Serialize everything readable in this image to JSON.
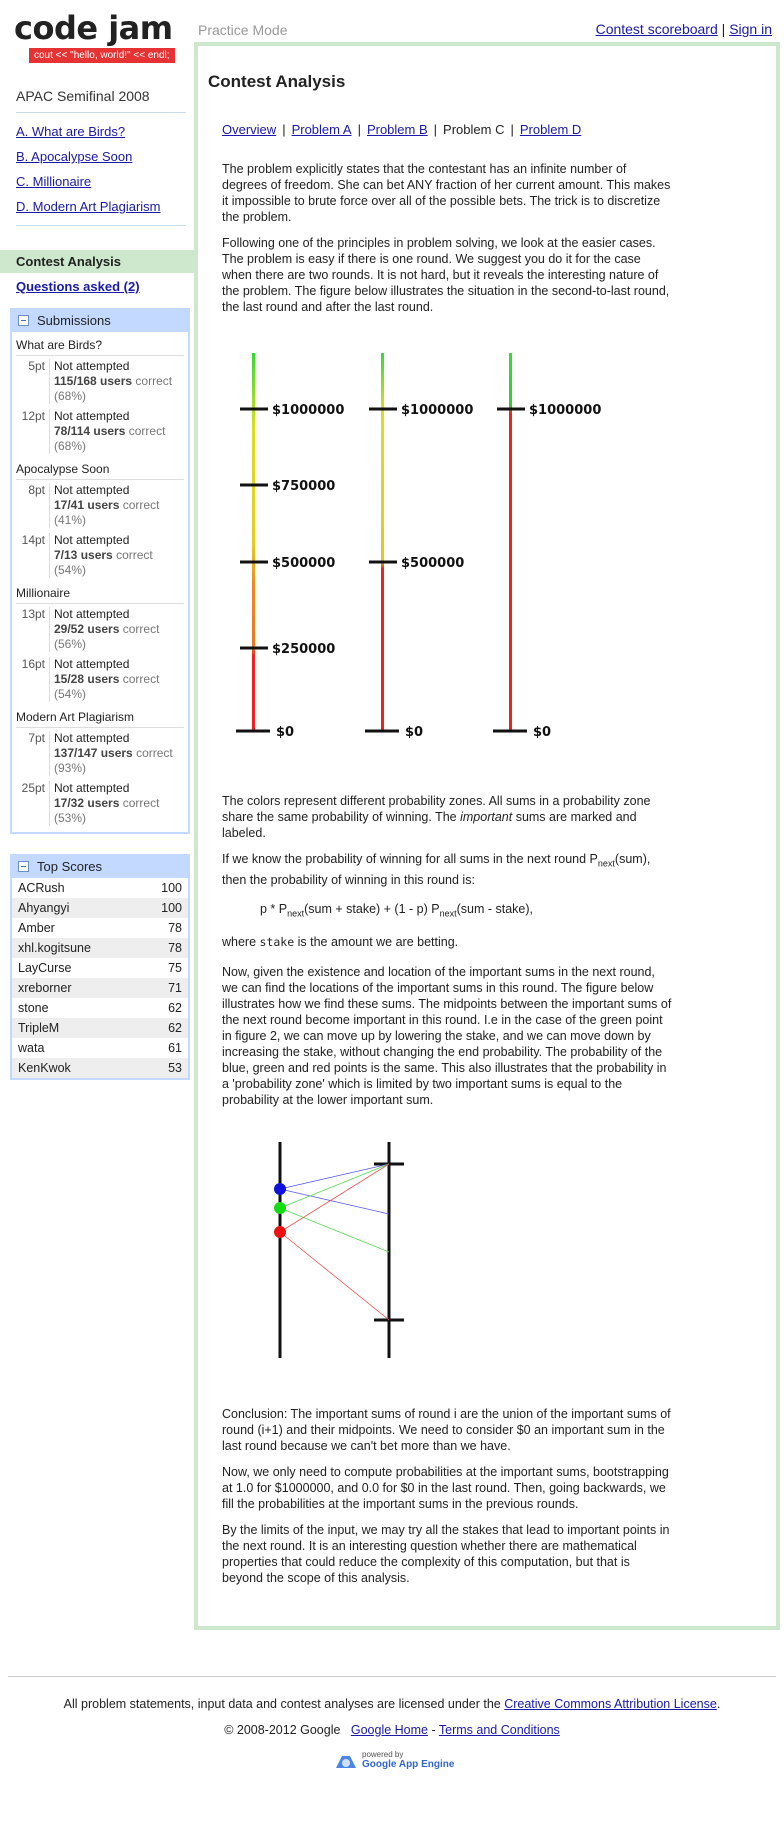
{
  "header": {
    "logo_text": "code jam",
    "logo_tagline": "cout << \"hello, world!\" << endl;",
    "mode": "Practice Mode",
    "scoreboard_link": "Contest scoreboard",
    "signin_link": "Sign in",
    "separator": "|"
  },
  "sidebar": {
    "contest_title": "APAC Semifinal 2008",
    "problems": [
      {
        "label": "A. What are Birds?"
      },
      {
        "label": "B. Apocalypse Soon"
      },
      {
        "label": "C. Millionaire"
      },
      {
        "label": "D. Modern Art Plagiarism"
      }
    ],
    "active_item": "Contest Analysis",
    "questions_link": "Questions asked (2)",
    "submissions": {
      "title": "Submissions",
      "groups": [
        {
          "name": "What are Birds?",
          "rows": [
            {
              "pts": "5pt",
              "status": "Not attempted",
              "ratio": "115/168 users",
              "correct": "correct",
              "pct": "(68%)"
            },
            {
              "pts": "12pt",
              "status": "Not attempted",
              "ratio": "78/114 users",
              "correct": "correct",
              "pct": "(68%)"
            }
          ]
        },
        {
          "name": "Apocalypse Soon",
          "rows": [
            {
              "pts": "8pt",
              "status": "Not attempted",
              "ratio": "17/41 users",
              "correct": "correct",
              "pct": "(41%)"
            },
            {
              "pts": "14pt",
              "status": "Not attempted",
              "ratio": "7/13 users",
              "correct": "correct",
              "pct": "(54%)"
            }
          ]
        },
        {
          "name": "Millionaire",
          "rows": [
            {
              "pts": "13pt",
              "status": "Not attempted",
              "ratio": "29/52 users",
              "correct": "correct",
              "pct": "(56%)"
            },
            {
              "pts": "16pt",
              "status": "Not attempted",
              "ratio": "15/28 users",
              "correct": "correct",
              "pct": "(54%)"
            }
          ]
        },
        {
          "name": "Modern Art Plagiarism",
          "rows": [
            {
              "pts": "7pt",
              "status": "Not attempted",
              "ratio": "137/147 users",
              "correct": "correct",
              "pct": "(93%)"
            },
            {
              "pts": "25pt",
              "status": "Not attempted",
              "ratio": "17/32 users",
              "correct": "correct",
              "pct": "(53%)"
            }
          ]
        }
      ]
    },
    "top_scores": {
      "title": "Top Scores",
      "rows": [
        {
          "name": "ACRush",
          "score": "100"
        },
        {
          "name": "Ahyangyi",
          "score": "100"
        },
        {
          "name": "Amber",
          "score": "78"
        },
        {
          "name": "xhl.kogitsune",
          "score": "78"
        },
        {
          "name": "LayCurse",
          "score": "75"
        },
        {
          "name": "xreborner",
          "score": "71"
        },
        {
          "name": "stone",
          "score": "62"
        },
        {
          "name": "TripleM",
          "score": "62"
        },
        {
          "name": "wata",
          "score": "61"
        },
        {
          "name": "KenKwok",
          "score": "53"
        }
      ]
    }
  },
  "main": {
    "title": "Contest Analysis",
    "nav": [
      {
        "label": "Overview",
        "link": true
      },
      {
        "label": "Problem A",
        "link": true
      },
      {
        "label": "Problem B",
        "link": true
      },
      {
        "label": "Problem C",
        "link": false
      },
      {
        "label": "Problem D",
        "link": true
      }
    ],
    "p1": "The problem explicitly states that the contestant has an infinite number of degrees of freedom. She can bet ANY fraction of her current amount. This makes it impossible to brute force over all of the possible bets. The trick is to discretize the problem.",
    "p2": "Following one of the principles in problem solving, we look at the easier cases. The problem is easy if there is one round. We suggest you do it for the case when there are two rounds. It is not hard, but it reveals the interesting nature of the problem. The figure below illustrates the situation in the second-to-last round, the last round and after the last round.",
    "figure1": {
      "col1_labels": [
        "$1000000",
        "$750000",
        "$500000",
        "$250000",
        "$0"
      ],
      "col2_labels": [
        "$1000000",
        "$500000",
        "$0"
      ],
      "col3_labels": [
        "$1000000",
        "$0"
      ]
    },
    "p3_a": "The colors represent different probability zones. All sums in a probability zone share the same probability of winning. The ",
    "p3_em": "important",
    "p3_b": " sums are marked and labeled.",
    "p4_a": "If we know the probability of winning for all sums in the next round P",
    "p4_sub": "next",
    "p4_b": "(sum), then the probability of winning in this round is:",
    "formula": {
      "part1": "p * P",
      "sub1": "next",
      "part2": "(sum + stake) + (1 - p) P",
      "sub2": "next",
      "part3": "(sum - stake),"
    },
    "p5_a": "where ",
    "p5_code": "stake",
    "p5_b": " is the amount we are betting.",
    "p6": "Now, given the existence and location of the important sums in the next round, we can find the locations of the important sums in this round. The figure below illustrates how we find these sums. The midpoints between the important sums of the next round become important in this round. I.e in the case of the green point in figure 2, we can move up by lowering the stake, and we can move down by increasing the stake, without changing the end probability. The probability of the blue, green and red points is the same. This also illustrates that the probability in a 'probability zone' which is limited by two important sums is equal to the probability at the lower important sum.",
    "p7": "Conclusion: The important sums of round i are the union of the important sums of round (i+1) and their midpoints. We need to consider $0 an important sum in the last round because we can't bet more than we have.",
    "p8": "Now, we only need to compute probabilities at the important sums, bootstrapping at 1.0 for $1000000, and 0.0 for $0 in the last round. Then, going backwards, we fill the probabilities at the important sums in the previous rounds.",
    "p9": "By the limits of the input, we may try all the stakes that lead to important points in the next round. It is an interesting question whether there are mathematical properties that could reduce the complexity of this computation, but that is beyond the scope of this analysis."
  },
  "footer": {
    "license_text": "All problem statements, input data and contest analyses are licensed under the ",
    "license_link": "Creative Commons Attribution License",
    "license_end": ".",
    "copyright": "© 2008-2012 Google",
    "google_home": "Google Home",
    "dash": "-",
    "terms": "Terms and Conditions",
    "powered": "powered by",
    "gae": "Google App Engine"
  },
  "colors": {
    "green_box": "#cde8cd",
    "blue_box": "#c3d9ff",
    "link": "#1a1aa6",
    "tag_red": "#e53333"
  }
}
